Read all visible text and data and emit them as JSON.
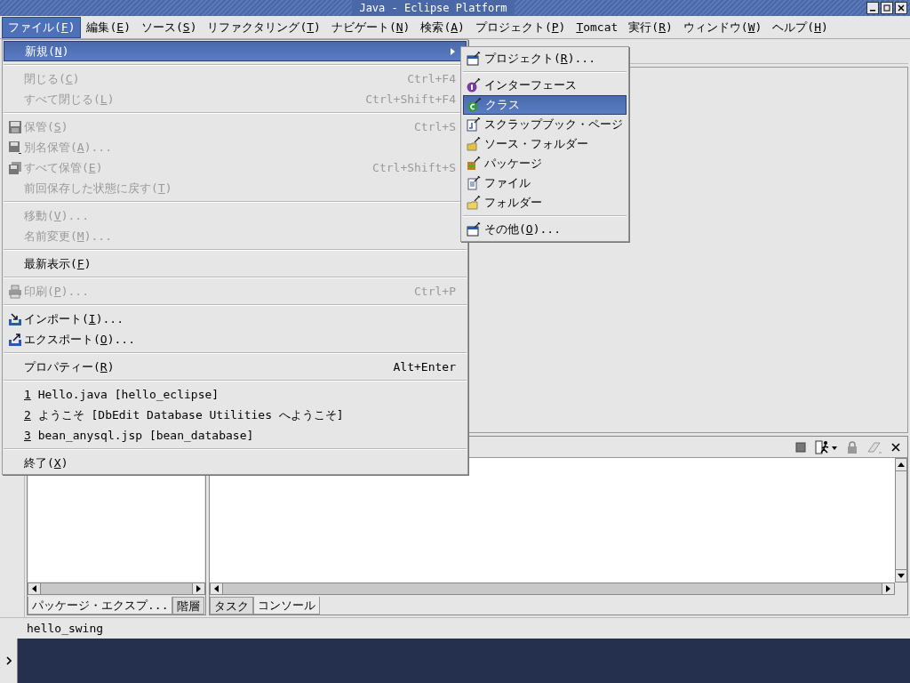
{
  "window": {
    "title": "Java - Eclipse Platform"
  },
  "menubar": [
    {
      "pre": "ファイル(",
      "key": "F",
      "post": ")",
      "selected": true
    },
    {
      "pre": "編集(",
      "key": "E",
      "post": ")",
      "selected": false
    },
    {
      "pre": "ソース(",
      "key": "S",
      "post": ")",
      "selected": false
    },
    {
      "pre": "リファクタリング(",
      "key": "T",
      "post": ")",
      "selected": false
    },
    {
      "pre": "ナビゲート(",
      "key": "N",
      "post": ")",
      "selected": false
    },
    {
      "pre": "検索(",
      "key": "A",
      "post": ")",
      "selected": false
    },
    {
      "pre": "プロジェクト(",
      "key": "P",
      "post": ")",
      "selected": false
    },
    {
      "key": "T",
      "post": "omcat",
      "selected": false
    },
    {
      "pre": "実行(",
      "key": "R",
      "post": ")",
      "selected": false
    },
    {
      "pre": "ウィンドウ(",
      "key": "W",
      "post": ")",
      "selected": false
    },
    {
      "pre": "ヘルプ(",
      "key": "H",
      "post": ")",
      "selected": false
    }
  ],
  "file_menu": [
    {
      "kind": "item",
      "pre": "新規(",
      "key": "N",
      "post": ")",
      "selected": true,
      "disabled": false,
      "submenu": true
    },
    {
      "kind": "separator"
    },
    {
      "kind": "item",
      "pre": "閉じる(",
      "key": "C",
      "post": ")",
      "shortcut": "Ctrl+F4",
      "selected": false,
      "disabled": true,
      "submenu": false
    },
    {
      "kind": "item",
      "pre": "すべて閉じる(",
      "key": "L",
      "post": ")",
      "shortcut": "Ctrl+Shift+F4",
      "selected": false,
      "disabled": true,
      "submenu": false
    },
    {
      "kind": "separator"
    },
    {
      "kind": "item",
      "pre": "保管(",
      "key": "S",
      "post": ")",
      "shortcut": "Ctrl+S",
      "selected": false,
      "disabled": true,
      "submenu": false
    },
    {
      "kind": "item",
      "pre": "別名保管(",
      "key": "A",
      "post": ")...",
      "selected": false,
      "disabled": true,
      "submenu": false
    },
    {
      "kind": "item",
      "pre": "すべて保管(",
      "key": "E",
      "post": ")",
      "shortcut": "Ctrl+Shift+S",
      "selected": false,
      "disabled": true,
      "submenu": false
    },
    {
      "kind": "item",
      "pre": "前回保存した状態に戻す(",
      "key": "T",
      "post": ")",
      "selected": false,
      "disabled": true,
      "submenu": false
    },
    {
      "kind": "separator"
    },
    {
      "kind": "item",
      "pre": "移動(",
      "key": "V",
      "post": ")...",
      "selected": false,
      "disabled": true,
      "submenu": false
    },
    {
      "kind": "item",
      "pre": "名前変更(",
      "key": "M",
      "post": ")...",
      "selected": false,
      "disabled": true,
      "submenu": false
    },
    {
      "kind": "separator"
    },
    {
      "kind": "item",
      "pre": "最新表示(",
      "key": "F",
      "post": ")",
      "selected": false,
      "disabled": false,
      "submenu": false
    },
    {
      "kind": "separator"
    },
    {
      "kind": "item",
      "pre": "印刷(",
      "key": "P",
      "post": ")...",
      "shortcut": "Ctrl+P",
      "selected": false,
      "disabled": true,
      "submenu": false
    },
    {
      "kind": "separator"
    },
    {
      "kind": "item",
      "pre": "インポート(",
      "key": "I",
      "post": ")...",
      "selected": false,
      "disabled": false,
      "submenu": false
    },
    {
      "kind": "item",
      "pre": "エクスポート(",
      "key": "O",
      "post": ")...",
      "selected": false,
      "disabled": false,
      "submenu": false
    },
    {
      "kind": "separator"
    },
    {
      "kind": "item",
      "pre": "プロパティー(",
      "key": "R",
      "post": ")",
      "shortcut": "Alt+Enter",
      "selected": false,
      "disabled": false,
      "submenu": false
    },
    {
      "kind": "separator"
    },
    {
      "kind": "item",
      "key": "1",
      "post": " Hello.java  [hello_eclipse]",
      "selected": false,
      "disabled": false,
      "submenu": false
    },
    {
      "kind": "item",
      "key": "2",
      "post": " ようこそ  [DbEdit Database Utilities へようこそ]",
      "selected": false,
      "disabled": false,
      "submenu": false
    },
    {
      "kind": "item",
      "key": "3",
      "post": " bean_anysql.jsp  [bean_database]",
      "selected": false,
      "disabled": false,
      "submenu": false
    },
    {
      "kind": "separator"
    },
    {
      "kind": "item",
      "pre": "終了(",
      "key": "X",
      "post": ")",
      "selected": false,
      "disabled": false,
      "submenu": false
    }
  ],
  "new_submenu": [
    {
      "kind": "item",
      "pre": "プロジェクト(",
      "key": "R",
      "post": ")...",
      "selected": false
    },
    {
      "kind": "separator"
    },
    {
      "kind": "item",
      "pre": "インターフェース",
      "selected": false
    },
    {
      "kind": "item",
      "pre": "クラス",
      "selected": true
    },
    {
      "kind": "item",
      "pre": "スクラップブック・ページ",
      "selected": false
    },
    {
      "kind": "item",
      "pre": "ソース・フォルダー",
      "selected": false
    },
    {
      "kind": "item",
      "pre": "パッケージ",
      "selected": false
    },
    {
      "kind": "item",
      "pre": "ファイル",
      "selected": false
    },
    {
      "kind": "item",
      "pre": "フォルダー",
      "selected": false
    },
    {
      "kind": "separator"
    },
    {
      "kind": "item",
      "pre": "その他(",
      "key": "O",
      "post": ")...",
      "selected": false
    }
  ],
  "left_view": {
    "tabs": [
      {
        "label": "パッケージ・エクスプ...",
        "selected": true
      },
      {
        "label": "階層",
        "selected": false
      }
    ]
  },
  "bottom_view": {
    "tabs": [
      {
        "label": "タスク",
        "selected": false
      },
      {
        "label": "コンソール",
        "selected": true
      }
    ]
  },
  "status_bar": "hello_swing"
}
